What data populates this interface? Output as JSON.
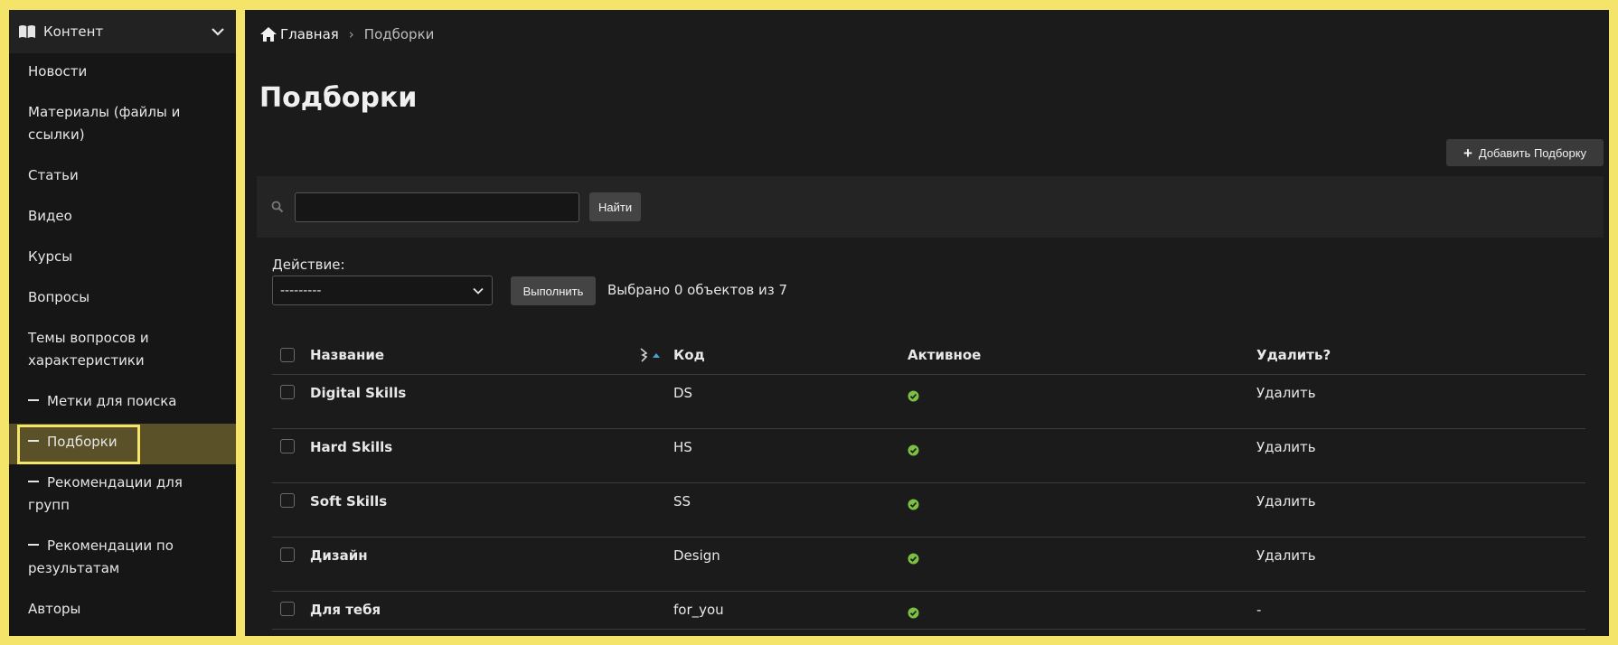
{
  "sidebar": {
    "section_title": "Контент",
    "items": [
      {
        "label": "Новости",
        "sub": false
      },
      {
        "label": "Материалы (файлы и ссылки)",
        "sub": false
      },
      {
        "label": "Статьи",
        "sub": false
      },
      {
        "label": "Видео",
        "sub": false
      },
      {
        "label": "Курсы",
        "sub": false
      },
      {
        "label": "Вопросы",
        "sub": false
      },
      {
        "label": "Темы вопросов и характеристики",
        "sub": false
      },
      {
        "label": "Метки для поиска",
        "sub": true
      },
      {
        "label": "Подборки",
        "sub": true,
        "active": true
      },
      {
        "label": "Рекомендации для групп",
        "sub": true
      },
      {
        "label": "Рекомендации по результатам",
        "sub": true
      },
      {
        "label": "Авторы",
        "sub": false
      }
    ]
  },
  "breadcrumb": {
    "home": "Главная",
    "separator": "›",
    "current": "Подборки"
  },
  "page": {
    "title": "Подборки",
    "add_button": "Добавить Подборку"
  },
  "search": {
    "value": "",
    "button": "Найти"
  },
  "actions": {
    "label": "Действие:",
    "selected_option": "---------",
    "run_button": "Выполнить",
    "selected_count": "Выбрано 0 объектов из 7"
  },
  "table": {
    "columns": {
      "name": "Название",
      "code": "Код",
      "active": "Активное",
      "delete": "Удалить?"
    },
    "rows": [
      {
        "name": "Digital Skills",
        "code": "DS",
        "active": true,
        "delete": "Удалить"
      },
      {
        "name": "Hard Skills",
        "code": "HS",
        "active": true,
        "delete": "Удалить"
      },
      {
        "name": "Soft Skills",
        "code": "SS",
        "active": true,
        "delete": "Удалить"
      },
      {
        "name": "Дизайн",
        "code": "Design",
        "active": true,
        "delete": "Удалить"
      },
      {
        "name": "Для тебя",
        "code": "for_you",
        "active": true,
        "delete": "-"
      }
    ]
  },
  "colors": {
    "accent": "#f5e46a",
    "active_bg": "#5a5128",
    "check": "#7bc043",
    "sort": "#4ea1d3"
  }
}
